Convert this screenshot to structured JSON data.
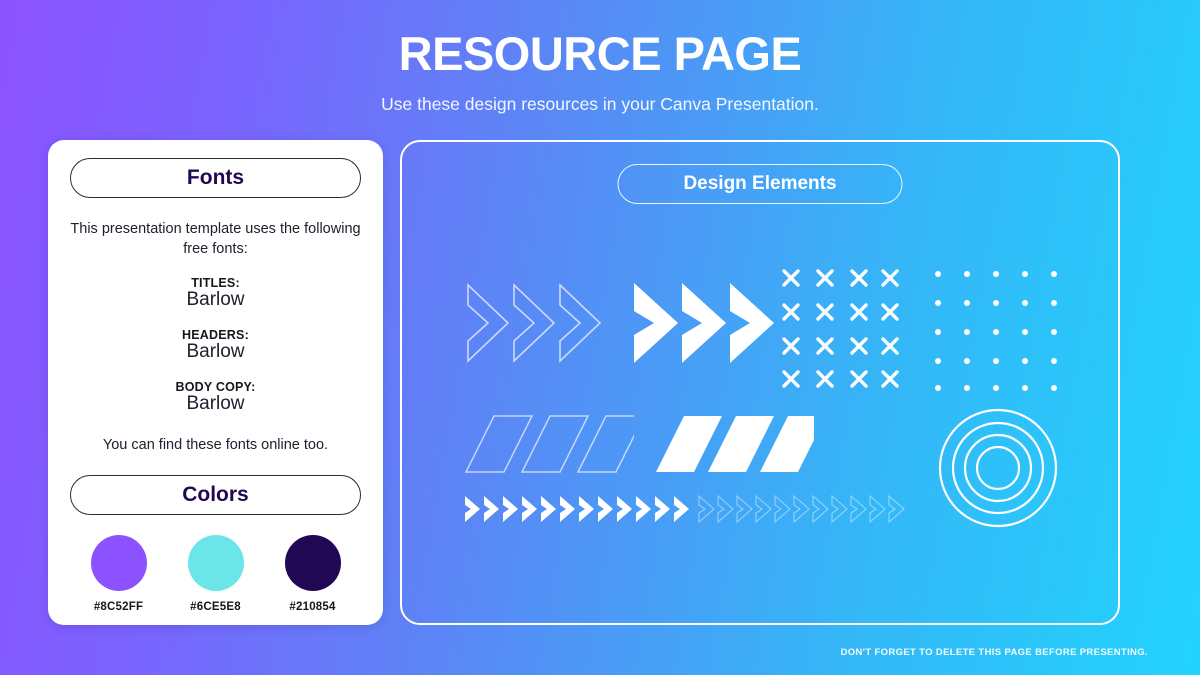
{
  "header": {
    "title": "RESOURCE PAGE",
    "subtitle": "Use these design resources in your Canva Presentation."
  },
  "fonts_card": {
    "heading": "Fonts",
    "intro": "This presentation template uses the following free fonts:",
    "entries": [
      {
        "role": "TITLES:",
        "font": "Barlow"
      },
      {
        "role": "HEADERS:",
        "font": "Barlow"
      },
      {
        "role": "BODY COPY:",
        "font": "Barlow"
      }
    ],
    "note": "You can find these fonts online too."
  },
  "colors_card": {
    "heading": "Colors",
    "swatches": [
      {
        "hex_label": "#8C52FF",
        "color": "#8C52FF"
      },
      {
        "hex_label": "#6CE5E8",
        "color": "#6CE5E8"
      },
      {
        "hex_label": "#210854",
        "color": "#210854"
      }
    ]
  },
  "elements_panel": {
    "heading": "Design Elements",
    "items": [
      {
        "name": "outline-chevrons",
        "count": 3
      },
      {
        "name": "solid-chevrons",
        "count": 3
      },
      {
        "name": "x-mark-grid",
        "rows": 4,
        "cols": 4
      },
      {
        "name": "dot-grid",
        "rows": 5,
        "cols": 5
      },
      {
        "name": "outline-parallelograms",
        "count": 3
      },
      {
        "name": "solid-parallelograms",
        "count": 3
      },
      {
        "name": "concentric-circles",
        "rings": 4
      },
      {
        "name": "solid-chevron-strip",
        "count": 12
      },
      {
        "name": "faded-chevron-strip",
        "count": 11
      }
    ]
  },
  "footer": {
    "note": "DON'T FORGET TO DELETE THIS PAGE BEFORE PRESENTING."
  },
  "theme": {
    "gradient_start": "#8C52FF",
    "gradient_end": "#22D3FD",
    "ink": "#210854",
    "paper": "#FFFFFF"
  }
}
